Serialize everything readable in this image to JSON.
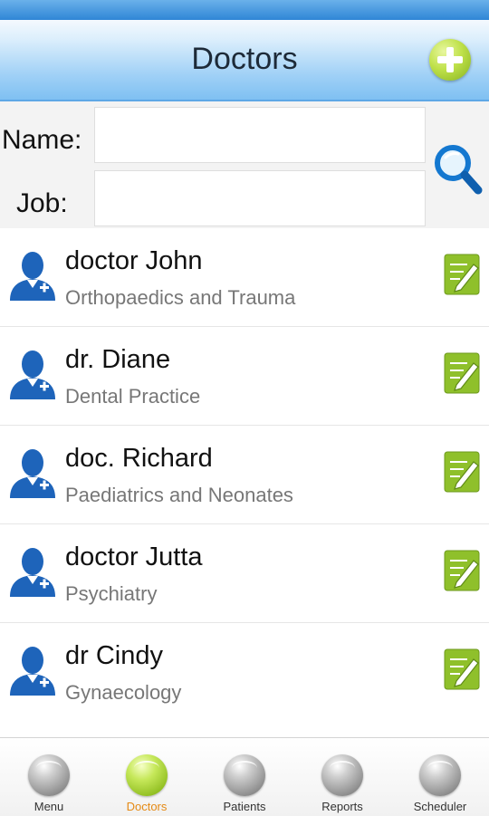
{
  "header": {
    "title": "Doctors"
  },
  "search": {
    "name_label": "Name:",
    "job_label": "Job:",
    "name_value": "",
    "job_value": ""
  },
  "doctors": [
    {
      "name": "doctor John",
      "job": "Orthopaedics and Trauma"
    },
    {
      "name": "dr. Diane",
      "job": "Dental Practice"
    },
    {
      "name": "doc. Richard",
      "job": "Paediatrics and Neonates"
    },
    {
      "name": "doctor Jutta",
      "job": "Psychiatry"
    },
    {
      "name": "dr Cindy",
      "job": "Gynaecology"
    }
  ],
  "nav": {
    "items": [
      {
        "label": "Menu",
        "icon": "menu-ball-icon"
      },
      {
        "label": "Doctors",
        "icon": "doctors-ball-icon",
        "active": true
      },
      {
        "label": "Patients",
        "icon": "patients-ball-icon"
      },
      {
        "label": "Reports",
        "icon": "reports-ball-icon"
      },
      {
        "label": "Scheduler",
        "icon": "scheduler-ball-icon"
      }
    ]
  },
  "colors": {
    "title_bar": "#9fd0f6",
    "accent_green": "#8ebc1f",
    "doctor_blue": "#1e64ba",
    "active_nav": "#e58a15"
  }
}
